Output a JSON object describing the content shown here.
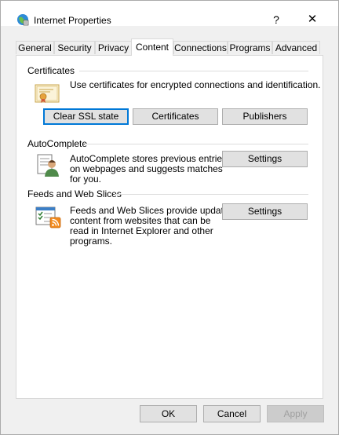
{
  "window": {
    "title": "Internet Properties",
    "help_glyph": "?",
    "close_glyph": "✕"
  },
  "tabs": [
    {
      "label": "General"
    },
    {
      "label": "Security"
    },
    {
      "label": "Privacy"
    },
    {
      "label": "Content",
      "active": true
    },
    {
      "label": "Connections"
    },
    {
      "label": "Programs"
    },
    {
      "label": "Advanced"
    }
  ],
  "certificates": {
    "title": "Certificates",
    "description": "Use certificates for encrypted connections and identification.",
    "clear_ssl_label": "Clear SSL state",
    "certificates_label": "Certificates",
    "publishers_label": "Publishers",
    "icon": "certificate-icon"
  },
  "autocomplete": {
    "title": "AutoComplete",
    "description_lines": [
      "AutoComplete stores previous entries",
      "on webpages and suggests matches",
      "for you."
    ],
    "settings_label": "Settings",
    "icon": "autocomplete-user-icon"
  },
  "feeds": {
    "title": "Feeds and Web Slices",
    "description_lines": [
      "Feeds and Web Slices provide updated",
      "content from websites that can be",
      "read in Internet Explorer and other",
      "programs."
    ],
    "settings_label": "Settings",
    "icon": "feed-rss-icon"
  },
  "footer": {
    "ok_label": "OK",
    "cancel_label": "Cancel",
    "apply_label": "Apply"
  },
  "colors": {
    "focus_accent": "#0078d7",
    "rss_orange": "#f28a1d"
  }
}
